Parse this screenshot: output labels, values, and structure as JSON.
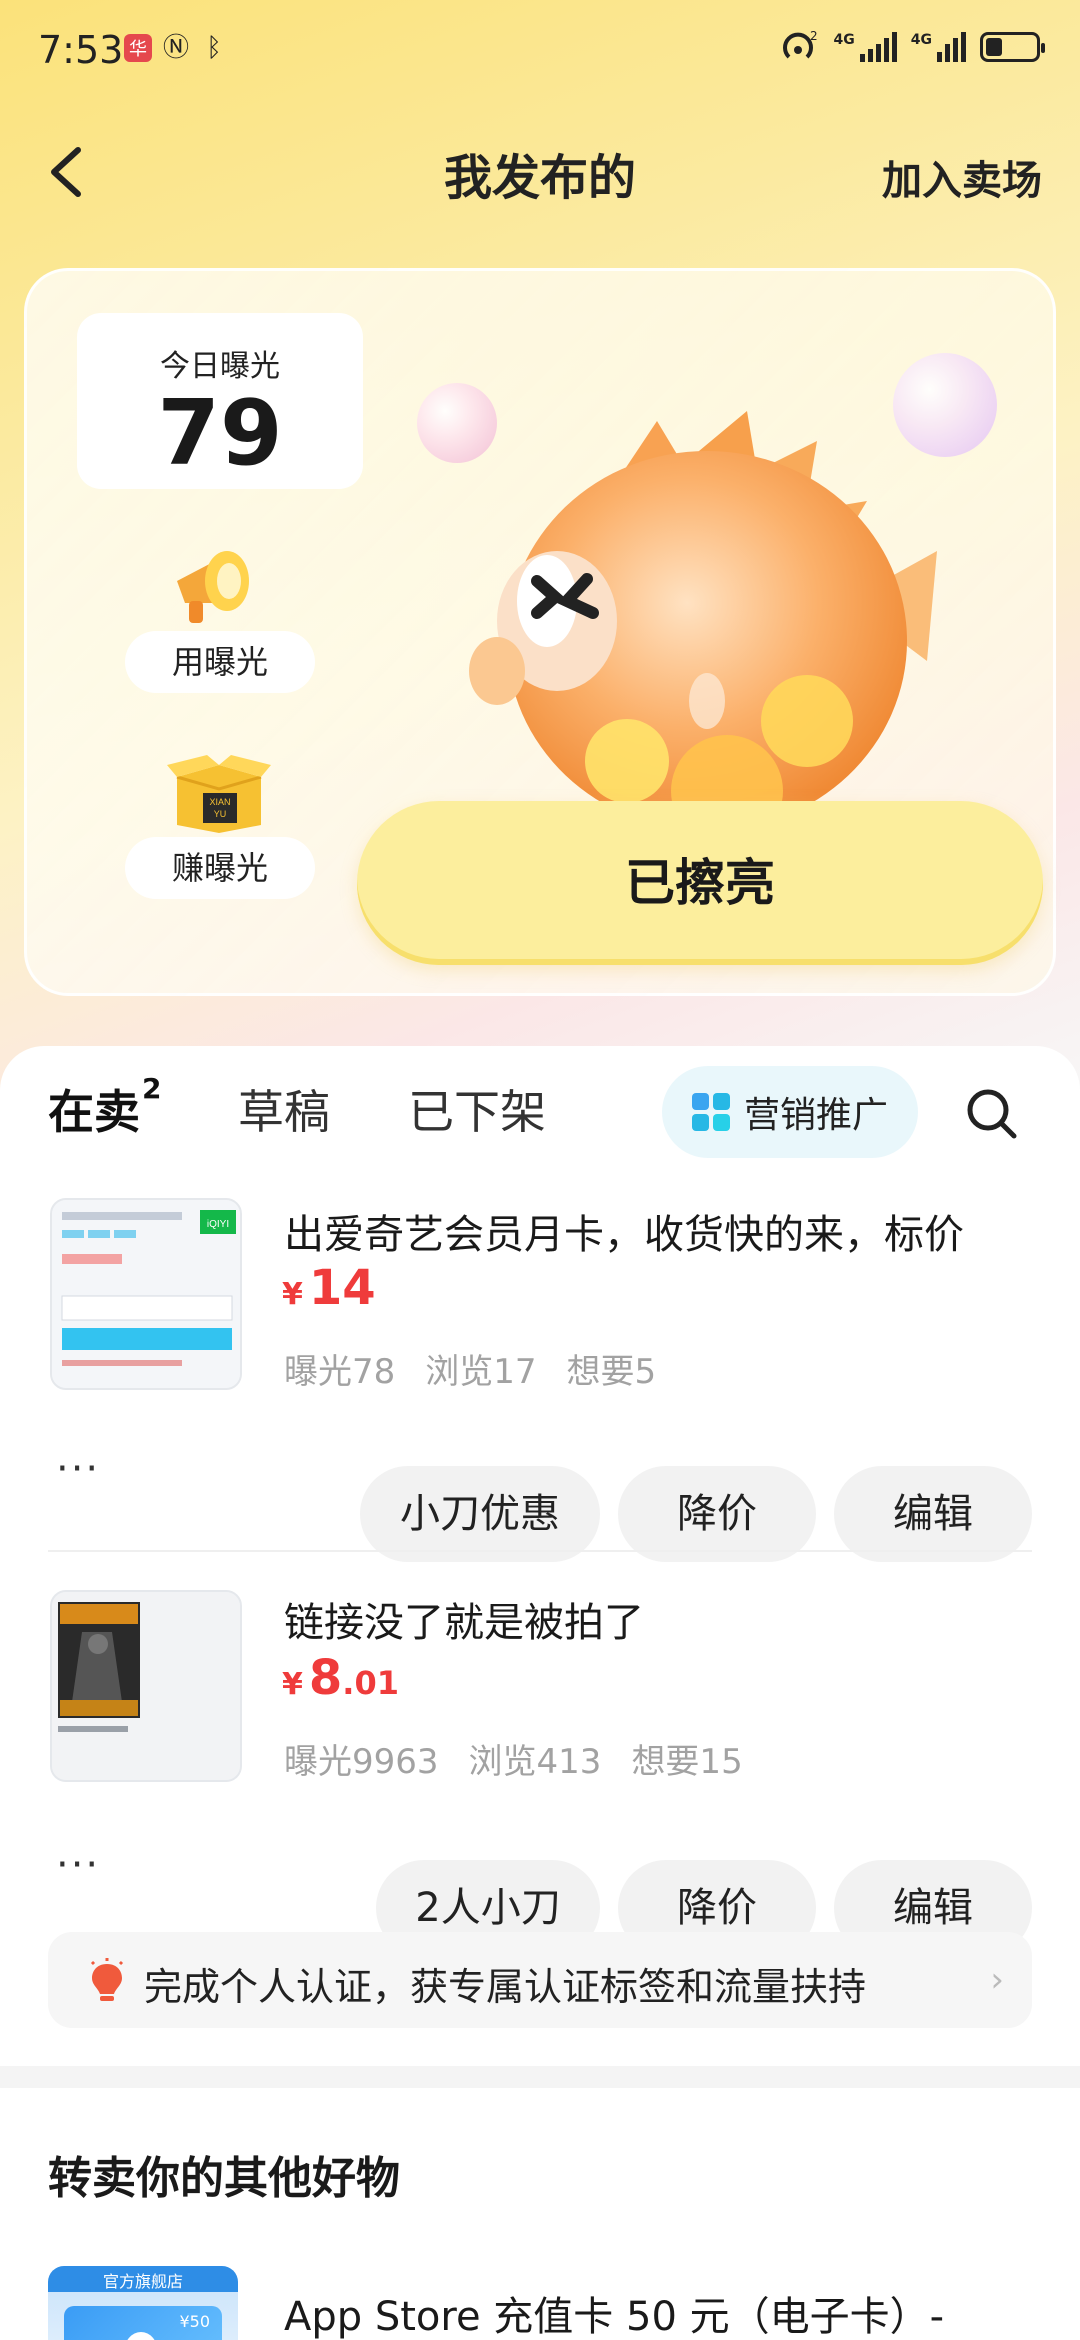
{
  "status_bar": {
    "time": "7:53",
    "network_label_1": "4G",
    "network_label_2": "4G",
    "wifi_badge": "2",
    "app_badge": "华"
  },
  "nav": {
    "title": "我发布的",
    "action": "加入卖场"
  },
  "hero": {
    "exposure_label": "今日曝光",
    "exposure_value": "79",
    "use_exposure": "用曝光",
    "earn_exposure": "赚曝光",
    "box_text_1": "XIAN",
    "box_text_2": "YU",
    "shine_status": "已擦亮"
  },
  "tabs": {
    "selling": "在卖",
    "selling_count": "2",
    "drafts": "草稿",
    "off_shelf": "已下架",
    "marketing": "营销推广"
  },
  "items": [
    {
      "title": "出爱奇艺会员月卡，收货快的来，标价",
      "price_symbol": "¥",
      "price_int": "14",
      "price_dec": "",
      "stats": [
        "曝光78",
        "浏览17",
        "想要5"
      ],
      "more": "···",
      "actions": [
        "小刀优惠",
        "降价",
        "编辑"
      ],
      "thumb_brand": "iQIYI"
    },
    {
      "title": "链接没了就是被拍了",
      "price_symbol": "¥",
      "price_int": "8",
      "price_dec": ".01",
      "stats": [
        "曝光9963",
        "浏览413",
        "想要15"
      ],
      "more": "···",
      "actions": [
        "2人小刀",
        "降价",
        "编辑"
      ]
    }
  ],
  "cert_banner": {
    "text": "完成个人认证，获专属认证标签和流量扶持",
    "chevron": "›"
  },
  "resell": {
    "title": "转卖你的其他好物",
    "badge": "官方旗舰店",
    "card_value": "¥50",
    "item_name": "App Store 充值卡 50 元（电子卡）-"
  },
  "colors": {
    "accent_yellow": "#ffd83a",
    "price_red": "#ef3b3b",
    "marketing_blue": "#27b8e5"
  }
}
